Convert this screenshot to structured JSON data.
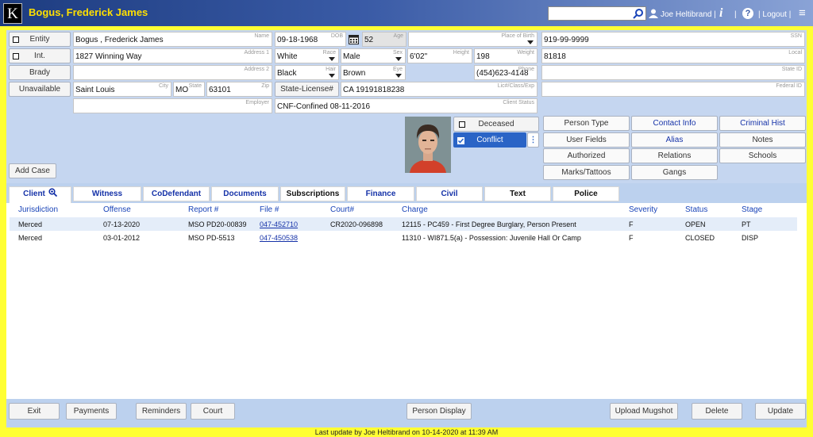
{
  "header": {
    "logo": "K",
    "title": "Bogus, Frederick James",
    "search_placeholder": "",
    "user": "Joe Heltibrand |",
    "info": "i",
    "pipe": "|",
    "help": "?",
    "logout": "| Logout |",
    "menu": "≡"
  },
  "form": {
    "entity_label": "Entity",
    "int_label": "Int.",
    "brady_label": "Brady",
    "unavailable_label": "Unavailable",
    "name": {
      "value": "Bogus , Frederick James",
      "label": "Name"
    },
    "address1": {
      "value": "1827 Winning Way",
      "label": "Address 1"
    },
    "address2": {
      "value": "",
      "label": "Address 2"
    },
    "city": {
      "value": "Saint Louis",
      "label": "City"
    },
    "state": {
      "value": "MO",
      "label": "State"
    },
    "zip": {
      "value": "63101",
      "label": "Zip"
    },
    "employer": {
      "value": "",
      "label": "Employer"
    },
    "dob": {
      "value": "09-18-1968",
      "label": "DOB"
    },
    "age": {
      "value": "52",
      "label": "Age"
    },
    "race": {
      "value": "White",
      "label": "Race"
    },
    "sex": {
      "value": "Male",
      "label": "Sex"
    },
    "height": {
      "value": "6'02\"",
      "label": "Height"
    },
    "weight": {
      "value": "198",
      "label": "Weight"
    },
    "hair": {
      "value": "Black",
      "label": "Hair"
    },
    "eye": {
      "value": "Brown",
      "label": "Eye"
    },
    "phone": {
      "value": "(454)623-4148",
      "label": "Phone"
    },
    "license_btn": "State-License#",
    "license": {
      "value": "CA 19191818238",
      "label": "Lic#/Class/Exp"
    },
    "client_status": {
      "value": "CNF-Confined 08-11-2016",
      "label": "Client Status"
    },
    "pob": {
      "value": "",
      "label": "Place of Birth"
    },
    "ssn": {
      "value": "919-99-9999",
      "label": "SSN"
    },
    "local": {
      "value": "81818",
      "label": "Local"
    },
    "state_id": {
      "value": "",
      "label": "State ID"
    },
    "federal_id": {
      "value": "",
      "label": "Federal ID"
    },
    "add_case": "Add Case",
    "deceased": "Deceased",
    "conflict": "Conflict",
    "side_buttons": [
      [
        "Person Type",
        "Contact Info",
        "Criminal Hist"
      ],
      [
        "User Fields",
        "Alias",
        "Notes"
      ],
      [
        "Authorized",
        "Relations",
        "Schools"
      ],
      [
        "Marks/Tattoos",
        "Gangs"
      ]
    ]
  },
  "tabs": [
    {
      "label": "Client"
    },
    {
      "label": "Witness"
    },
    {
      "label": "CoDefendant"
    },
    {
      "label": "Documents"
    },
    {
      "label": "Subscriptions"
    },
    {
      "label": "Finance"
    },
    {
      "label": "Civil"
    },
    {
      "label": "Text"
    },
    {
      "label": "Police"
    }
  ],
  "table": {
    "columns": [
      "Jurisdiction",
      "Offense",
      "Report #",
      "File #",
      "Court#",
      "Charge",
      "Severity",
      "Status",
      "Stage"
    ],
    "rows": [
      [
        "Merced",
        "07-13-2020",
        "MSO PD20-00839",
        "047-452710",
        "CR2020-096898",
        "12115 - PC459 - First Degree Burglary, Person Present",
        "F",
        "OPEN",
        "PT"
      ],
      [
        "Merced",
        "03-01-2012",
        "MSO PD-5513",
        "047-450538",
        "",
        "11310 - WI871.5(a) - Possession: Juvenile Hall Or Camp",
        "F",
        "CLOSED",
        "DISP"
      ]
    ]
  },
  "footer": {
    "buttons": [
      "Exit",
      "Payments",
      "Reminders",
      "Court",
      "Person Display",
      "Upload Mugshot",
      "Delete",
      "Update"
    ]
  },
  "status": "Last update by Joe Heltibrand on 10-14-2020 at 11:39 AM",
  "colors": {
    "header_start": "#1d3c80",
    "title": "#ffe000",
    "accent": "#1532a8",
    "conflict": "#2a64c6",
    "background": "#ffff33"
  }
}
